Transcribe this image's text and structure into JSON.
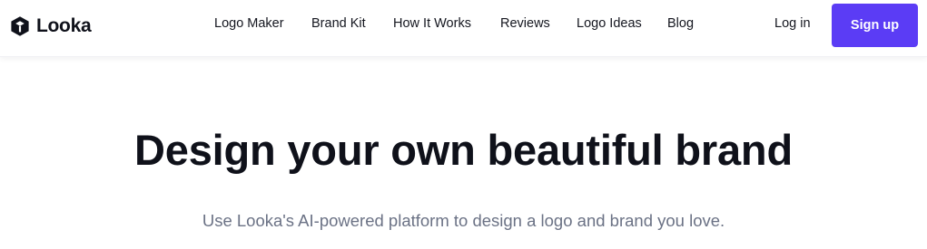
{
  "brand": {
    "name": "Looka",
    "logo_icon": "looka-hexagon-icon",
    "logo_color": "#0f111a"
  },
  "nav": {
    "items": [
      {
        "label": "Logo Maker"
      },
      {
        "label": "Brand Kit"
      },
      {
        "label": "How It Works"
      },
      {
        "label": "Reviews"
      },
      {
        "label": "Logo Ideas"
      },
      {
        "label": "Blog"
      }
    ],
    "login_label": "Log in",
    "signup_label": "Sign up"
  },
  "hero": {
    "title": "Design your own beautiful brand",
    "subtitle": "Use Looka's AI-powered platform to design a logo and brand you love."
  },
  "colors": {
    "accent": "#5b3cf5",
    "text": "#0f111a",
    "muted": "#6b7285"
  }
}
